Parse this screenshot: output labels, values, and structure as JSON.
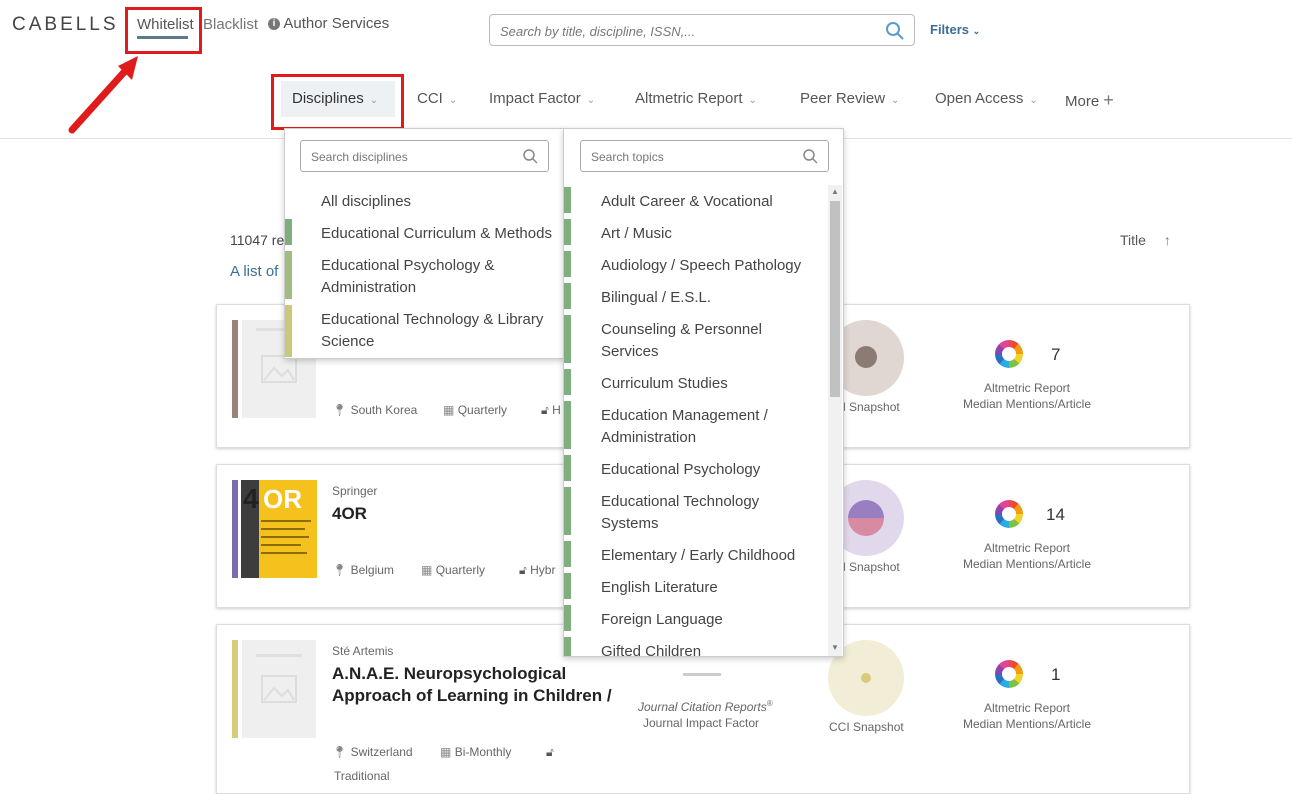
{
  "brand": {
    "logo": "CABELLS"
  },
  "top_nav": {
    "whitelist": "Whitelist",
    "blacklist": "Blacklist",
    "author_services": "Author Services"
  },
  "search": {
    "placeholder": "Search by title, discipline, ISSN,..."
  },
  "filters": {
    "label": "Filters"
  },
  "main_nav": [
    {
      "label": "Disciplines"
    },
    {
      "label": "CCI"
    },
    {
      "label": "Impact Factor"
    },
    {
      "label": "Altmetric Report"
    },
    {
      "label": "Peer Review"
    },
    {
      "label": "Open Access"
    },
    {
      "label": "More"
    }
  ],
  "results": {
    "count": "11047 re",
    "list_text": "A list of",
    "sort_label": "Title"
  },
  "disciplines_dropdown": {
    "placeholder": "Search disciplines",
    "items": [
      {
        "label": "All disciplines",
        "color": ""
      },
      {
        "label": "Educational Curriculum & Methods",
        "color": "#7fae7f"
      },
      {
        "label": "Educational Psychology & Administration",
        "color": "#9fbd7f"
      },
      {
        "label": "Educational Technology & Library Science",
        "color": "#c9c97a"
      }
    ]
  },
  "topics_dropdown": {
    "placeholder": "Search topics",
    "items": [
      "Adult Career & Vocational",
      "Art / Music",
      "Audiology / Speech Pathology",
      "Bilingual / E.S.L.",
      "Counseling & Personnel Services",
      "Curriculum Studies",
      "Education Management / Administration",
      "Educational Psychology",
      "Educational Technology Systems",
      "Elementary / Early Childhood",
      "English Literature",
      "Foreign Language",
      "Gifted Children"
    ],
    "bar_color": "#7fae7f"
  },
  "cards": [
    {
      "stripe_color": "#9a8378",
      "publisher": "",
      "title": "",
      "country": "South Korea",
      "frequency": "Quarterly",
      "access": "H",
      "cci_label": "l Snapshot",
      "cci_color": "#e0d6d2",
      "cci_dot": "#8c7b72",
      "altmetric_value": "7",
      "altmetric_label": "Altmetric Report",
      "altmetric_sublabel": "Median Mentions/Article"
    },
    {
      "stripe_color": "#7d6bb0",
      "publisher": "Springer",
      "title": "4OR",
      "country": "Belgium",
      "frequency": "Quarterly",
      "access": "Hybr",
      "cci_label": "l Snapshot",
      "cci_color": "#e2d8ec",
      "cci_dot": "#9d7fbf",
      "altmetric_value": "14",
      "altmetric_label": "Altmetric Report",
      "altmetric_sublabel": "Median Mentions/Article"
    },
    {
      "stripe_color": "#d6cc7a",
      "publisher": "Sté Artemis",
      "title": "A.N.A.E. Neuropsychological Approach of Learning in Children /",
      "country": "Switzerland",
      "frequency": "Bi-Monthly",
      "access": "Traditional",
      "jcr_label": "Journal Citation Reports",
      "jcr_sup": "®",
      "jif_label": "Journal Impact Factor",
      "cci_label": "CCI Snapshot",
      "cci_color": "#f2edd6",
      "cci_dot": "#d6cc7a",
      "altmetric_value": "1",
      "altmetric_label": "Altmetric Report",
      "altmetric_sublabel": "Median Mentions/Article"
    }
  ]
}
